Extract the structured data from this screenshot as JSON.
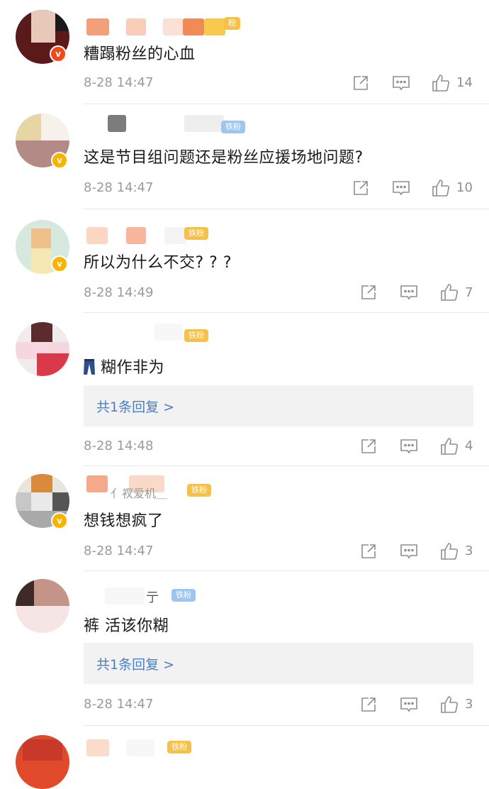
{
  "comments": [
    {
      "text": "糟蹋粉丝的心血",
      "time": "8-28 14:47",
      "likes": "14",
      "tag": "粉",
      "tag_color": "#f5c14a",
      "badge": "red"
    },
    {
      "text": "这是节目组问题还是粉丝应援场地问题?",
      "time": "8-28 14:47",
      "likes": "10",
      "tag": "铁粉",
      "tag_color": "#9cc6f0",
      "badge": "yellow"
    },
    {
      "text": "所以为什么不交? ? ?",
      "time": "8-28 14:49",
      "likes": "7",
      "tag": "铁粉",
      "tag_color": "#f5c14a",
      "badge": "yellow"
    },
    {
      "text": "糊作非为",
      "time": "8-28 14:48",
      "likes": "4",
      "tag": "铁粉",
      "tag_color": "#f5c14a",
      "reply": "共1条回复 >"
    },
    {
      "text": "想钱想疯了",
      "time": "8-28 14:47",
      "likes": "3",
      "tag": "铁粉",
      "tag_color": "#f5c14a",
      "badge": "yellow",
      "name_fragment": "亻衩爱机＿"
    },
    {
      "text": "裤 活该你糊",
      "time": "8-28 14:47",
      "likes": "3",
      "tag": "铁粉",
      "tag_color": "#9cc6f0",
      "reply": "共1条回复 >",
      "name_fragment": "亍"
    },
    {
      "tag": "铁粉",
      "tag_color": "#f5c14a"
    }
  ]
}
